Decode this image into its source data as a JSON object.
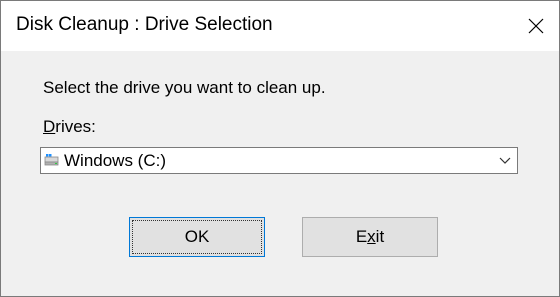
{
  "window": {
    "title": "Disk Cleanup : Drive Selection"
  },
  "content": {
    "prompt": "Select the drive you want to clean up.",
    "drives_label_mnemonic": "D",
    "drives_label_rest": "rives:"
  },
  "drive_select": {
    "selected": "Windows (C:)",
    "icon": "windows-drive-icon"
  },
  "buttons": {
    "ok_label": "OK",
    "exit_label_pre": "E",
    "exit_label_mnemonic": "x",
    "exit_label_post": "it"
  },
  "colors": {
    "focus_border": "#0078d7",
    "button_bg": "#e1e1e1",
    "dialog_bg": "#f0f0f0"
  }
}
